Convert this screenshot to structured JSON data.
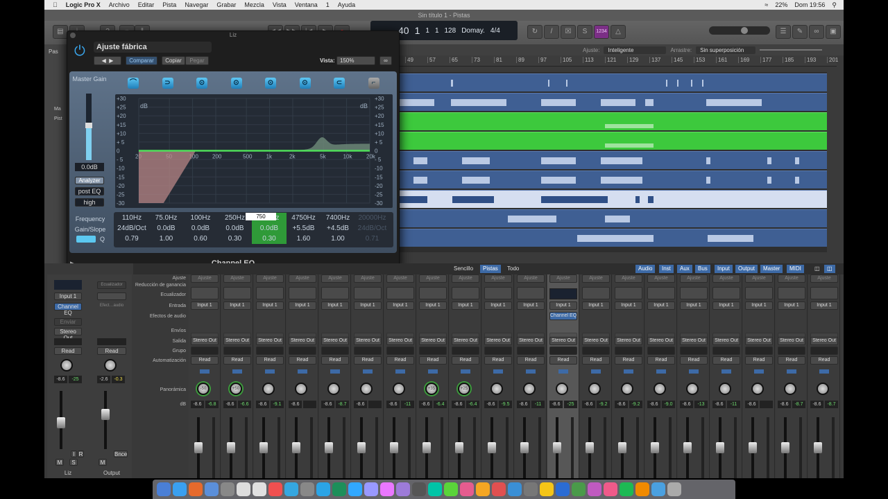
{
  "menubar": {
    "apple": "",
    "app": "Logic Pro X",
    "items": [
      "Archivo",
      "Editar",
      "Pista",
      "Navegar",
      "Grabar",
      "Mezcla",
      "Vista",
      "Ventana",
      "1",
      "Ayuda"
    ],
    "battery": "22%",
    "clock": "Dom 19:56"
  },
  "window": {
    "title": "Sin título 1 - Pistas"
  },
  "lcd": {
    "bar": "40",
    "beat": "1",
    "div": "1",
    "tick": "1",
    "tempo": "128",
    "key": "Domay.",
    "signature": "4/4"
  },
  "toolbar": {
    "count_in": "1234"
  },
  "arrange": {
    "snap_label": "Ajuste:",
    "snap_value": "Inteligente",
    "drag_label": "Arrastre:",
    "drag_value": "Sin superposición",
    "ruler": [
      "49",
      "57",
      "65",
      "73",
      "81",
      "89",
      "97",
      "105",
      "113",
      "121",
      "129",
      "137",
      "145",
      "153",
      "161",
      "169",
      "177",
      "185",
      "193",
      "201"
    ],
    "track_colors": {
      "normal": "#3f5f93",
      "selected": "#3dc93d"
    }
  },
  "sidebar": {
    "items": [
      "Pas",
      "Ma",
      "Pist"
    ]
  },
  "plugin": {
    "window_title": "Liz",
    "preset": "Ajuste fábrica",
    "compare": "Comparar",
    "copy": "Copiar",
    "paste": "Pegar",
    "view_label": "Vista:",
    "view_value": "150%",
    "name": "Channel EQ",
    "master_gain_label": "Master Gain",
    "master_gain": "0.0dB",
    "analyzer": "Analyzer",
    "analyzer_mode": "post EQ",
    "resolution": "high",
    "db_ticks": [
      "+30",
      "+25",
      "+20",
      "+15",
      "+10",
      "+ 5",
      "0",
      "- 5",
      "-10",
      "-15",
      "-20",
      "-25",
      "-30"
    ],
    "db_unit": "dB",
    "freq_ticks": [
      "20",
      "50",
      "100",
      "200",
      "500",
      "1k",
      "2k",
      "5k",
      "10k",
      "20k"
    ],
    "row_labels": {
      "freq": "Frequency",
      "gain": "Gain/Slope",
      "q": "Q"
    },
    "edit_value": "750",
    "bands": [
      {
        "freq": "110Hz",
        "gain": "24dB/Oct",
        "q": "0.79",
        "icon": "low-cut-icon",
        "on": true
      },
      {
        "freq": "75.0Hz",
        "gain": "0.0dB",
        "q": "1.00",
        "icon": "low-shelf-icon",
        "on": true
      },
      {
        "freq": "100Hz",
        "gain": "0.0dB",
        "q": "0.60",
        "icon": "bell-icon",
        "on": true
      },
      {
        "freq": "250Hz",
        "gain": "0.0dB",
        "q": "0.30",
        "icon": "bell-icon",
        "on": true
      },
      {
        "freq": "750Hz",
        "gain": "0.0dB",
        "q": "0.30",
        "icon": "bell-icon",
        "on": true,
        "selected": true
      },
      {
        "freq": "4750Hz",
        "gain": "+5.5dB",
        "q": "1.60",
        "icon": "bell-icon",
        "on": true
      },
      {
        "freq": "7400Hz",
        "gain": "+4.5dB",
        "q": "1.00",
        "icon": "high-shelf-icon",
        "on": true
      },
      {
        "freq": "20000Hz",
        "gain": "24dB/Oct",
        "q": "0.71",
        "icon": "high-cut-icon",
        "on": false
      }
    ]
  },
  "mixer": {
    "view_tabs": [
      "Sencillo",
      "Pistas",
      "Todo"
    ],
    "active_view": "Pistas",
    "filters": [
      "Audio",
      "Inst",
      "Aux",
      "Bus",
      "Input",
      "Output",
      "Master",
      "MIDI"
    ],
    "row_labels": [
      "Ajuste",
      "Reducción de ganancia",
      "Ecualizador",
      "Entrada",
      "Efectos de audio",
      "Envíos",
      "Salida",
      "Grupo",
      "Automatización",
      "Panorámica",
      "dB"
    ],
    "setting": "Ajuste",
    "input": "Input 1",
    "output": "Stereo Out",
    "automation": "Read",
    "plugin_slot": "Channel EQ",
    "channels": [
      {
        "pan": "-50",
        "vol": "-8.6",
        "peak": "-6.8"
      },
      {
        "pan": "+50",
        "vol": "-8.6",
        "peak": "-6.6"
      },
      {
        "pan": "",
        "vol": "-8.6",
        "peak": "-9.1"
      },
      {
        "pan": "",
        "vol": "-8.6",
        "peak": ""
      },
      {
        "pan": "",
        "vol": "-8.6",
        "peak": "-8.7"
      },
      {
        "pan": "",
        "vol": "-8.6",
        "peak": ""
      },
      {
        "pan": "",
        "vol": "-8.6",
        "peak": "-11"
      },
      {
        "pan": "+35",
        "vol": "-8.6",
        "peak": "-6.4"
      },
      {
        "pan": "+25",
        "vol": "-8.6",
        "peak": "-6.4"
      },
      {
        "pan": "",
        "vol": "-8.6",
        "peak": "-9.5"
      },
      {
        "pan": "",
        "vol": "-8.6",
        "peak": "-11"
      },
      {
        "pan": "",
        "vol": "-8.6",
        "peak": "-25",
        "selected": true
      },
      {
        "pan": "",
        "vol": "-8.6",
        "peak": "-9.2"
      },
      {
        "pan": "",
        "vol": "-8.6",
        "peak": "-9.2"
      },
      {
        "pan": "",
        "vol": "-8.6",
        "peak": "-9.0"
      },
      {
        "pan": "",
        "vol": "-8.6",
        "peak": "-13"
      },
      {
        "pan": "",
        "vol": "-8.6",
        "peak": "-11"
      },
      {
        "pan": "",
        "vol": "-8.6",
        "peak": ""
      },
      {
        "pan": "",
        "vol": "-8.6",
        "peak": "-8.7"
      },
      {
        "pan": "",
        "vol": "-8.6",
        "peak": "-8.7"
      }
    ]
  },
  "inspector": {
    "ch1": {
      "name": "Liz",
      "input": "Input 1",
      "plugin": "Channel EQ",
      "send": "Enviar",
      "output": "Stereo Out",
      "automation": "Read",
      "vol": "-8.6",
      "peak": "-25",
      "m": "M",
      "s": "S",
      "i": "I",
      "r": "R"
    },
    "ch2": {
      "name": "Output",
      "eq": "Ecualizador",
      "fx": "Efect…audio",
      "automation": "Read",
      "vol": "-2.6",
      "peak": "-0.3",
      "m": "M",
      "bnce": "Bnce"
    }
  }
}
